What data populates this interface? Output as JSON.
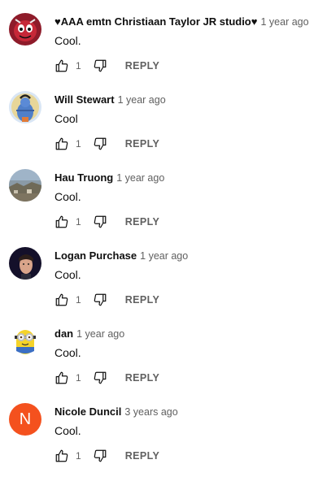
{
  "comments": [
    {
      "author": "♥AAA emtn Christiaan Taylor JR studio♥",
      "time": "1 year ago",
      "text": "Cool.",
      "likes": "1",
      "reply_label": "REPLY",
      "avatar": "red-cartoon-face"
    },
    {
      "author": "Will Stewart",
      "time": "1 year ago",
      "text": "Cool",
      "likes": "1",
      "reply_label": "REPLY",
      "avatar": "blue-deity-illustration"
    },
    {
      "author": "Hau Truong",
      "time": "1 year ago",
      "text": "Cool.",
      "likes": "1",
      "reply_label": "REPLY",
      "avatar": "landscape-photo"
    },
    {
      "author": "Logan Purchase",
      "time": "1 year ago",
      "text": "Cool.",
      "likes": "1",
      "reply_label": "REPLY",
      "avatar": "portrait-photo"
    },
    {
      "author": "dan",
      "time": "1 year ago",
      "text": "Cool.",
      "likes": "1",
      "reply_label": "REPLY",
      "avatar": "minion-character"
    },
    {
      "author": "Nicole Duncil",
      "time": "3 years ago",
      "text": "Cool.",
      "likes": "1",
      "reply_label": "REPLY",
      "avatar": "letter-initial",
      "avatar_letter": "N",
      "avatar_color": "#f4511e"
    }
  ]
}
